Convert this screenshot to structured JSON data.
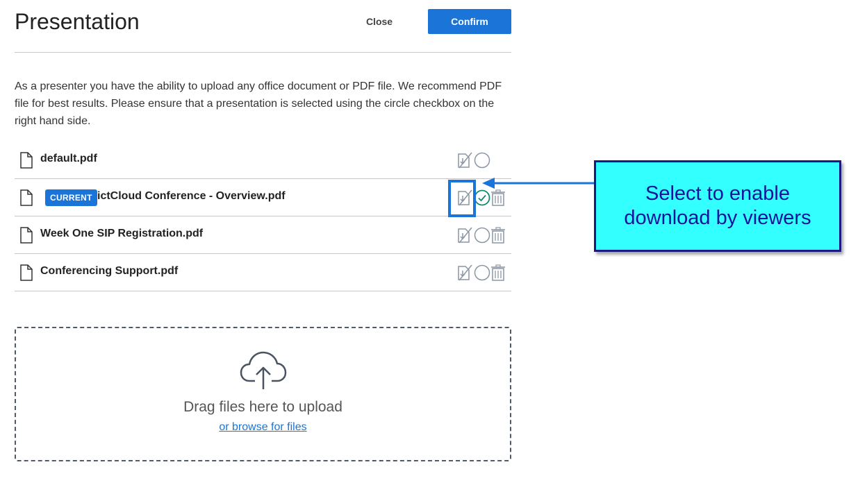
{
  "header": {
    "title": "Presentation",
    "close_label": "Close",
    "confirm_label": "Confirm"
  },
  "intro_text": "As a presenter you have the ability to upload any office document or PDF file. We recommend PDF file for best results. Please ensure that a presentation is selected using the circle checkbox on the right hand side.",
  "files": [
    {
      "name": "default.pdf",
      "current": false,
      "selected": false,
      "deletable": false
    },
    {
      "name": "ictCloud Conference - Overview.pdf",
      "current": true,
      "badge": "CURRENT",
      "selected": true,
      "deletable": true
    },
    {
      "name": "Week One SIP Registration.pdf",
      "current": false,
      "selected": false,
      "deletable": true
    },
    {
      "name": "Conferencing Support.pdf",
      "current": false,
      "selected": false,
      "deletable": true
    }
  ],
  "upload": {
    "drag_text": "Drag files here to upload",
    "browse_text": "or browse for files"
  },
  "annotation": {
    "callout_line1": "Select to enable",
    "callout_line2": "download by viewers"
  },
  "colors": {
    "accent": "#1b74d8",
    "selected_check": "#0f8a6b",
    "icon_gray": "#8a96a3",
    "callout_bg": "#33ffff",
    "callout_text": "#15159a"
  },
  "icons": {
    "file": "file-icon",
    "download": "download-toggle-icon",
    "select": "select-circle-icon",
    "selected": "check-circle-icon",
    "delete": "trash-icon",
    "upload": "cloud-upload-icon"
  }
}
